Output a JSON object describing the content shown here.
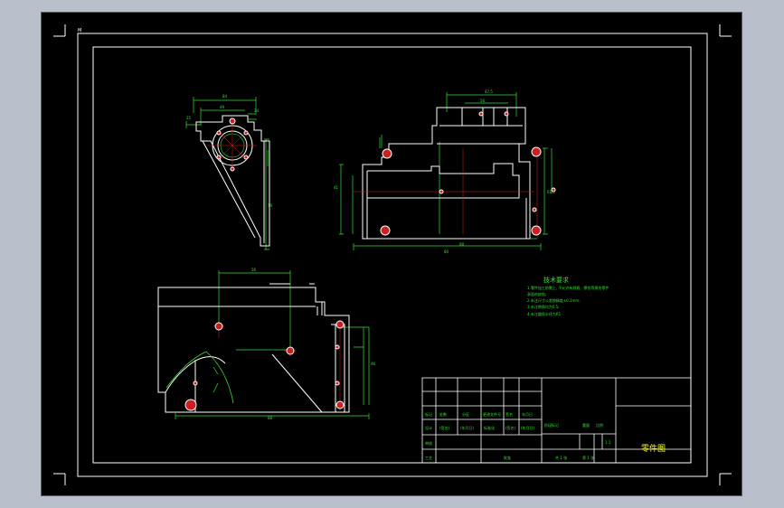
{
  "viewport": {
    "background": "#000000",
    "corner_mark": "M"
  },
  "colors": {
    "outline": "#ffffff",
    "dimension": "#33e033",
    "centerline": "#e02020",
    "hole_fill": "#cc2020",
    "title_text": "#ffff00"
  },
  "drawing": {
    "view_front_top": {
      "dims": [
        "84",
        "49",
        "25",
        "24",
        "19",
        "14",
        "4",
        "60"
      ]
    },
    "view_side": {
      "dims": [
        "47.5",
        "56",
        "80",
        "88",
        "41",
        "61.5"
      ]
    },
    "view_bottom": {
      "dims": [
        "56",
        "88",
        "46"
      ]
    }
  },
  "notes": {
    "title": "技术要求",
    "lines": [
      "1.零件加工前需上, 不允许有划痕、擦伤等损伤零件",
      "表面的缺陷;",
      "2.未注尺寸公差按精度±0.1mm;",
      "3.未注倒角均为0.5;",
      "4.未注圆角半径为R1"
    ]
  },
  "title_block": {
    "row_sign": [
      "标记",
      "处数",
      "分区",
      "更改文件号",
      "签名",
      "年月日"
    ],
    "row_design": [
      "设计",
      "(签名)",
      "(年月日)",
      "标准化",
      "(签名)",
      "(年月日)"
    ],
    "stage_label": "阶段标记",
    "weight_label": "重量",
    "scale_label": "比例",
    "scale_value": "1:1",
    "check_label": "审核",
    "process_label": "工艺",
    "approve_label": "批准",
    "sheets_total": "共 1 张",
    "sheet_no": "第 1 张",
    "drawing_name": "零件图"
  }
}
